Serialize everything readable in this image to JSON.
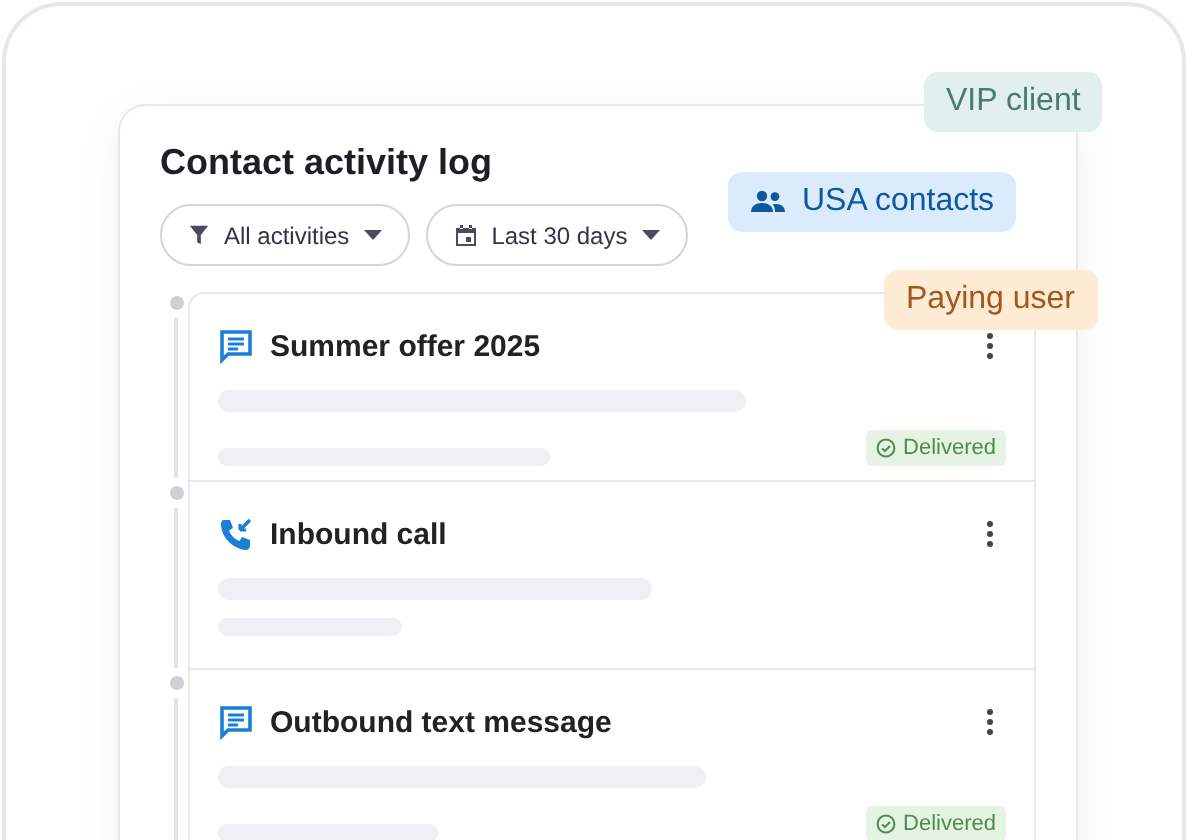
{
  "card": {
    "title": "Contact activity log"
  },
  "filters": [
    {
      "kind": "filter",
      "label": "All activities"
    },
    {
      "kind": "date",
      "label": "Last 30 days"
    }
  ],
  "activities": [
    {
      "kind": "message",
      "title": "Summer offer 2025",
      "status": "Delivered"
    },
    {
      "kind": "call",
      "title": "Inbound call"
    },
    {
      "kind": "message",
      "title": "Outbound text message",
      "status": "Delivered"
    }
  ],
  "tags": [
    {
      "label": "VIP client",
      "color": "#e1f0ec",
      "icon": false
    },
    {
      "label": "USA contacts",
      "color": "#dcebfb",
      "icon": true
    },
    {
      "label": "Paying user",
      "color": "#fdebd3",
      "icon": false
    }
  ]
}
